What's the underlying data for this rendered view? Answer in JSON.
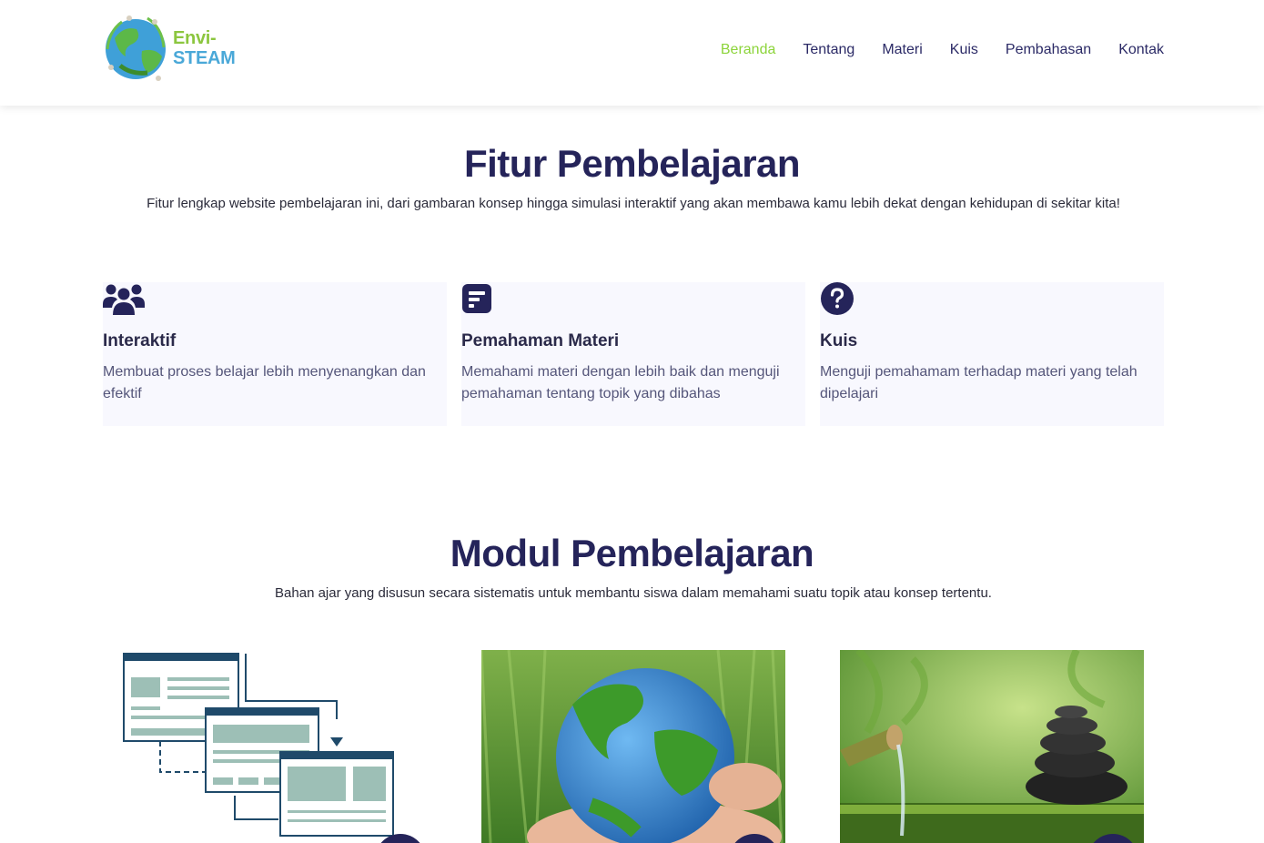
{
  "header": {
    "logo": {
      "line1": "Envi-",
      "line2": "STEAM"
    },
    "nav": [
      {
        "label": "Beranda",
        "active": true
      },
      {
        "label": "Tentang"
      },
      {
        "label": "Materi"
      },
      {
        "label": "Kuis"
      },
      {
        "label": "Pembahasan"
      },
      {
        "label": "Kontak"
      }
    ]
  },
  "features": {
    "title": "Fitur Pembelajaran",
    "subtitle": "Fitur lengkap website pembelajaran ini, dari gambaran konsep hingga simulasi interaktif yang akan membawa kamu lebih dekat dengan kehidupan di sekitar kita!",
    "cards": [
      {
        "icon": "users-icon",
        "title": "Interaktif",
        "desc": "Membuat proses belajar lebih menyenangkan dan efektif"
      },
      {
        "icon": "document-icon",
        "title": "Pemahaman Materi",
        "desc": "Memahami materi dengan lebih baik dan menguji pemahaman tentang topik yang dibahas"
      },
      {
        "icon": "question-circle-icon",
        "title": "Kuis",
        "desc": "Menguji pemahamam terhadap materi yang telah dipelajari"
      }
    ]
  },
  "modules": {
    "title": "Modul Pembelajaran",
    "subtitle": "Bahan ajar yang disusun secara sistematis untuk membantu siswa dalam memahami suatu topik atau konsep tertentu.",
    "items": [
      {
        "image": "wireframe-pages-illustration"
      },
      {
        "image": "earth-in-hand-photo"
      },
      {
        "image": "bamboo-zen-stones-photo"
      }
    ]
  },
  "colors": {
    "accent": "#8cd43a",
    "navy": "#25245a",
    "card_bg": "#f8f8fe"
  }
}
